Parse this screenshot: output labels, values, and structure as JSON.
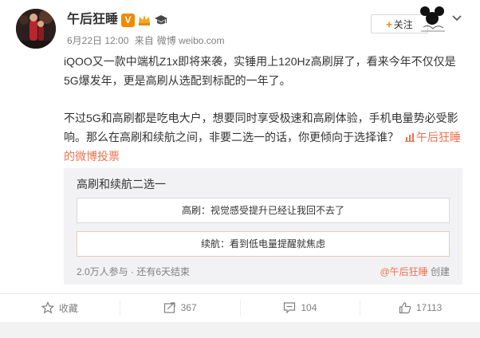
{
  "post": {
    "author": "午后狂睡",
    "date": "6月22日 12:00",
    "source_prefix": "来自",
    "source": "微博 weibo.com",
    "follow_label": "关注",
    "paragraph1": "iQOO又一款中端机Z1x即将来袭，实锤用上120Hz高刷屏了，看来今年不仅仅是5G爆发年，更是高刷从选配到标配的一年了。",
    "paragraph2": "不过5G和高刷都是吃电大户，想要同时享受极速和高刷体验，手机电量势必受影响。那么在高刷和续航之间，非要二选一的话，你更倾向于选择谁？",
    "link_text": "午后狂睡的微博投票"
  },
  "poll": {
    "title": "高刷和续航二选一",
    "options": [
      "高刷：视觉感受提升已经让我回不去了",
      "续航：看到低电量提醒就焦虑"
    ],
    "stats": "2.0万人参与 · 还有6天结束",
    "creator": "@午后狂睡",
    "creator_suffix": "创建"
  },
  "actions": {
    "favorite_label": "收藏",
    "repost_count": "367",
    "comment_count": "104",
    "like_count": "17113"
  },
  "colors": {
    "accent": "#eb7350",
    "brand_orange": "#ff8200",
    "verified": "#f08a00"
  }
}
